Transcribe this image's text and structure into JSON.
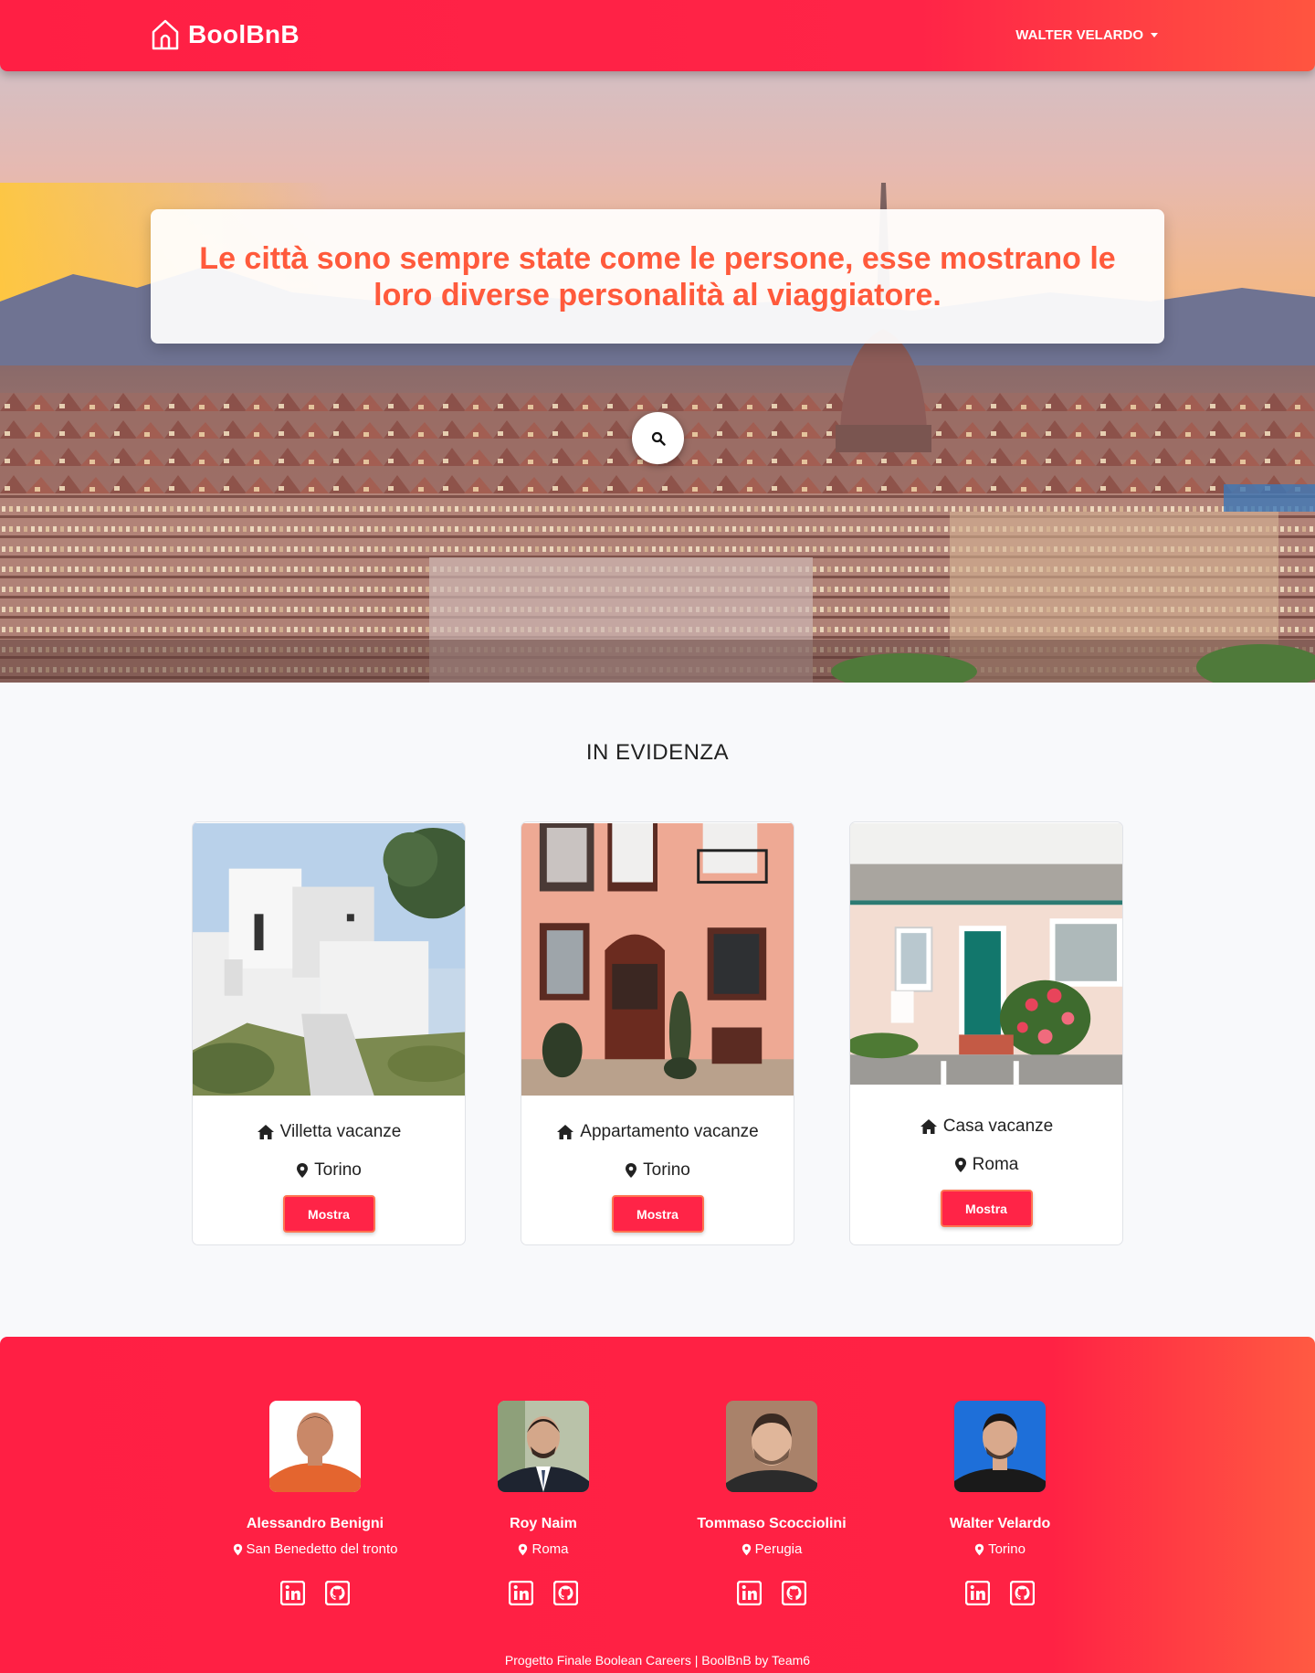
{
  "nav": {
    "brand": "BoolBnB",
    "user": "WALTER VELARDO"
  },
  "hero": {
    "quote": "Le città sono sempre state come le persone, esse mostrano le loro diverse personalità al viaggiatore."
  },
  "featured": {
    "title": "IN EVIDENZA",
    "cards": [
      {
        "title": "Villetta vacanze",
        "city": "Torino",
        "button": "Mostra"
      },
      {
        "title": "Appartamento vacanze",
        "city": "Torino",
        "button": "Mostra"
      },
      {
        "title": "Casa vacanze",
        "city": "Roma",
        "button": "Mostra"
      }
    ]
  },
  "footer": {
    "members": [
      {
        "name": "Alessandro Benigni",
        "city": "San Benedetto del tronto"
      },
      {
        "name": "Roy Naim",
        "city": "Roma"
      },
      {
        "name": "Tommaso Scocciolini",
        "city": "Perugia"
      },
      {
        "name": "Walter Velardo",
        "city": "Torino"
      }
    ],
    "copyright": "Progetto Finale Boolean Careers | BoolBnB by Team6"
  },
  "colors": {
    "brand_red": "#ff2447",
    "accent_orange": "#ff5a3c"
  },
  "icons": [
    "house-logo-icon",
    "caret-down-icon",
    "search-icon",
    "home-icon",
    "map-marker-icon",
    "linkedin-icon",
    "github-icon"
  ]
}
